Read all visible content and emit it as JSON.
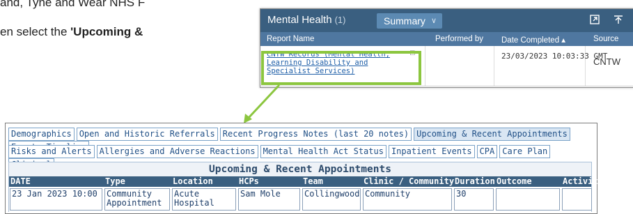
{
  "document": {
    "line1": "and, Tyne and Wear NHS F",
    "line2_prefix": "en select the ",
    "line2_bold": "'Upcoming &"
  },
  "widget": {
    "title": "Mental Health",
    "count": "(1)",
    "view_select": "Summary",
    "columns": [
      "Report Name",
      "Performed by",
      "Date Completed ▴",
      "Source"
    ],
    "row": {
      "report_name": "CNTW Records (Mental Health, Learning Disability and Specialist Services)",
      "performed_by": "",
      "date_completed": "23/03/2023 10:03:33 GMT",
      "source": "CNTW"
    },
    "highlight_color": "#8cc63f"
  },
  "panel": {
    "tabs_row1": [
      "Demographics",
      "Open and Historic Referrals",
      "Recent Progress Notes (last 20 notes)",
      "Upcoming & Recent Appointments",
      "Events Timeline"
    ],
    "tabs_row2": [
      "Risks and Alerts",
      "Allergies and Adverse Reactions",
      "Mental Health Act Status",
      "Inpatient Events",
      "CPA",
      "Care Plan",
      "Clinical"
    ],
    "active_tab": "Upcoming & Recent Appointments",
    "section_title": "Upcoming & Recent Appointments",
    "table": {
      "headers": [
        "DATE",
        "Type",
        "Location",
        "HCPs",
        "Team",
        "Clinic / Community",
        "Duration",
        "Outcome",
        "Activity"
      ],
      "rows": [
        [
          "23 Jan 2023 10:00",
          "Community Appointment",
          "Acute Hospital",
          "Sam Mole",
          "Collingwood",
          "Community",
          "30",
          "",
          ""
        ]
      ]
    }
  }
}
